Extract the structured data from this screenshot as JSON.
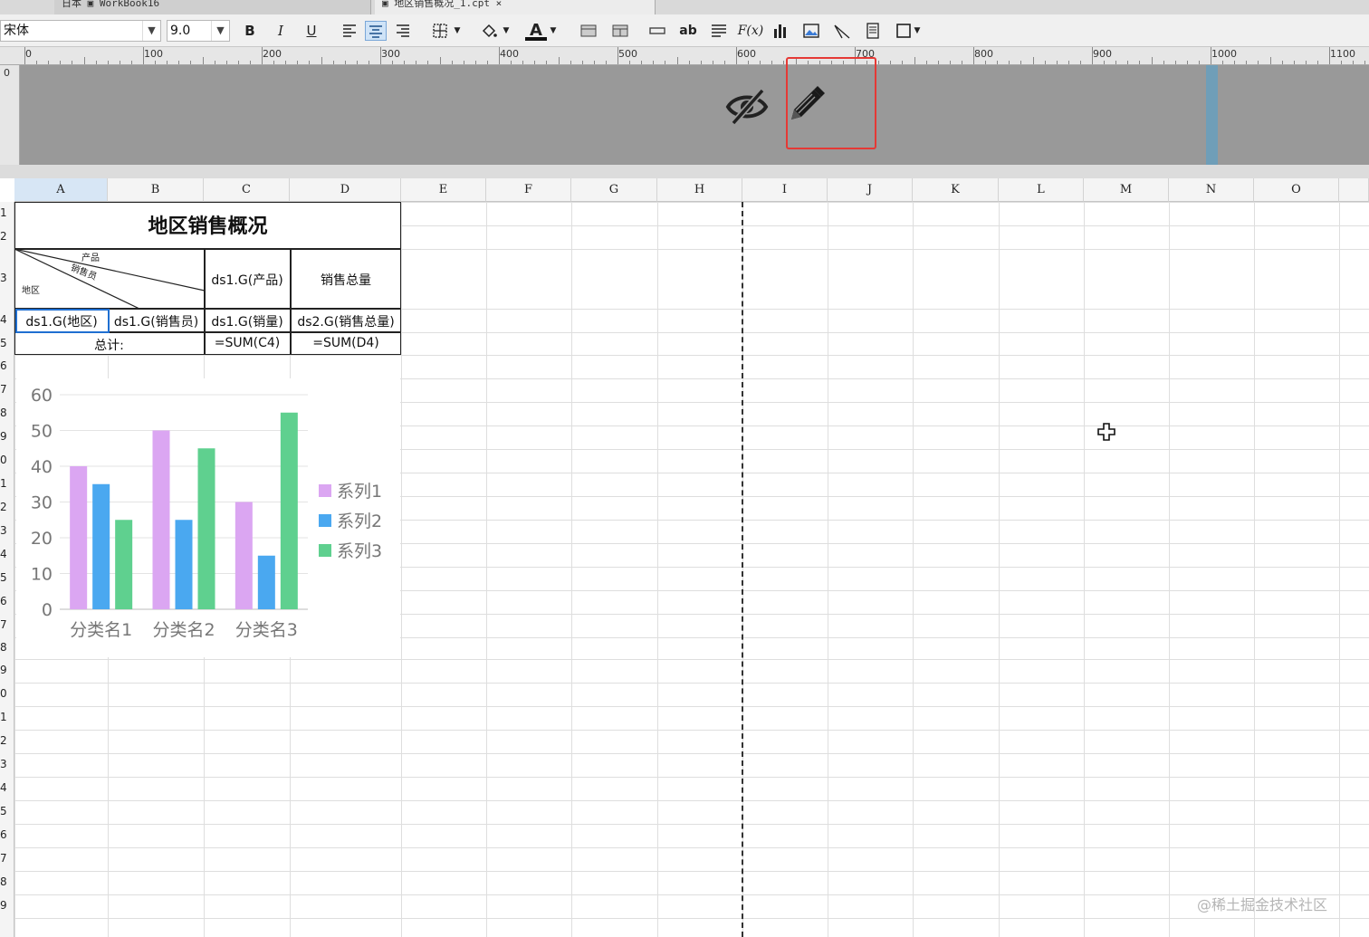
{
  "tabs": [
    {
      "label": "日本  ▣  WorkBook16",
      "close": "×"
    },
    {
      "label": "▣  地区销售概况_1.cpt  ×",
      "close": "×"
    }
  ],
  "toolbar": {
    "font_name": "宋体",
    "font_size": "9.0",
    "bold_label": "B",
    "italic_label": "I",
    "underline_label": "U",
    "color_label": "A",
    "text_label": "ab",
    "formula_label": "F(x)"
  },
  "ruler": {
    "labels": [
      "0",
      "100",
      "200",
      "300",
      "400",
      "500",
      "600",
      "700",
      "800",
      "900",
      "1000",
      "1100"
    ],
    "vertical_label": "0"
  },
  "columns": [
    "A",
    "B",
    "C",
    "D",
    "E",
    "F",
    "G",
    "H",
    "I",
    "J",
    "K",
    "L",
    "M",
    "N",
    "O"
  ],
  "rows": [
    "1",
    "2",
    "3",
    "4",
    "5",
    "6",
    "7",
    "8",
    "9",
    "0",
    "1",
    "2",
    "3",
    "4",
    "5",
    "6",
    "7",
    "8",
    "9",
    "0",
    "1",
    "2",
    "3",
    "4",
    "5",
    "6",
    "7",
    "8",
    "9"
  ],
  "report": {
    "title": "地区销售概况",
    "header_product": "产品",
    "header_salesman": "销售员",
    "header_region": "地区",
    "c3": "ds1.G(产品)",
    "d3": "销售总量",
    "a4": "ds1.G(地区)",
    "b4": "ds1.G(销售员)",
    "c4": "ds1.G(销量)",
    "d4": "ds2.G(销售总量)",
    "ab5": "总计:",
    "c5": "=SUM(C4)",
    "d5": "=SUM(D4)"
  },
  "chart_data": {
    "type": "bar",
    "categories": [
      "分类名1",
      "分类名2",
      "分类名3"
    ],
    "series": [
      {
        "name": "系列1",
        "values": [
          40,
          50,
          30
        ],
        "color": "#dba6f2"
      },
      {
        "name": "系列2",
        "values": [
          35,
          25,
          15
        ],
        "color": "#4aa8f0"
      },
      {
        "name": "系列3",
        "values": [
          25,
          45,
          55
        ],
        "color": "#5fd08f"
      }
    ],
    "yticks": [
      0,
      10,
      20,
      30,
      40,
      50,
      60
    ],
    "ylim": [
      0,
      60
    ],
    "legend": "right",
    "grid": true
  },
  "watermark": "@稀土掘金技术社区"
}
